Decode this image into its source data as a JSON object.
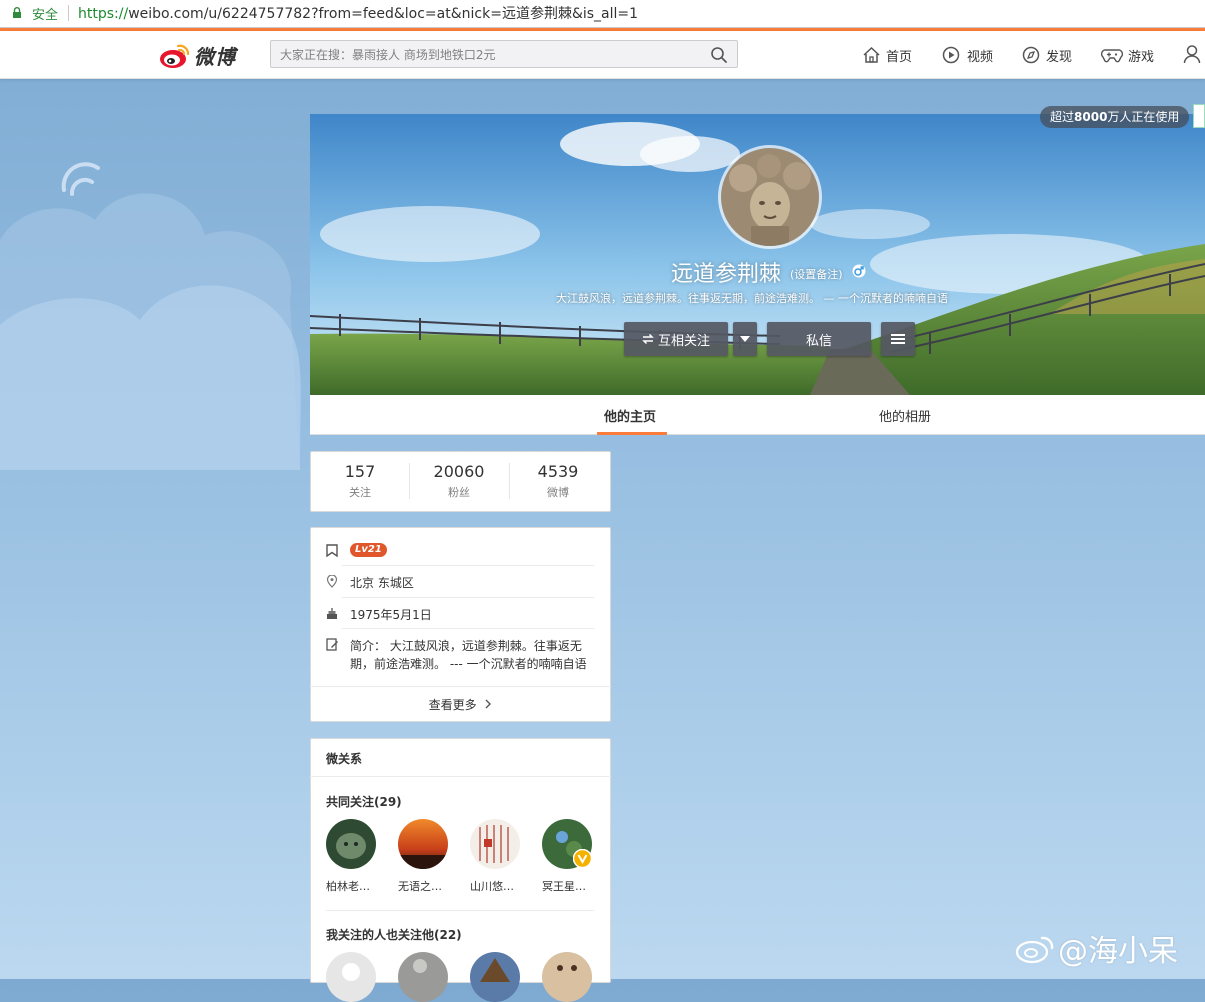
{
  "browser": {
    "secure_label": "安全",
    "url_proto": "https://",
    "url_rest": "weibo.com/u/6224757782?from=feed&loc=at&nick=远道参荆棘&is_all=1"
  },
  "header": {
    "logo_text": "微博",
    "search_placeholder": "大家正在搜：暴雨接人 商场到地铁口2元",
    "nav": [
      {
        "label": "首页",
        "icon": "home-icon"
      },
      {
        "label": "视频",
        "icon": "video-icon"
      },
      {
        "label": "发现",
        "icon": "compass-icon"
      },
      {
        "label": "游戏",
        "icon": "gamepad-icon"
      }
    ]
  },
  "cover": {
    "badge_prefix": "超过",
    "badge_number": "8000",
    "badge_suffix": "万人正在使用",
    "nickname": "远道参荆棘",
    "remark": "(设置备注)",
    "bio": "大江鼓风浪，远道参荆棘。往事返无期，前途浩难测。 — 一个沉默者的喃喃自语",
    "follow_button": "互相关注",
    "message_button": "私信"
  },
  "tabs": [
    {
      "label": "他的主页",
      "active": true
    },
    {
      "label": "他的相册",
      "active": false
    }
  ],
  "stats": [
    {
      "value": "157",
      "label": "关注"
    },
    {
      "value": "20060",
      "label": "粉丝"
    },
    {
      "value": "4539",
      "label": "微博"
    }
  ],
  "info": {
    "level": "Lv21",
    "location": "北京 东城区",
    "birthday": "1975年5月1日",
    "bio_line1": "简介： 大江鼓风浪，远道参荆棘。往事返无",
    "bio_line2": "期，前途浩难测。 --- 一个沉默者的喃喃自语",
    "more": "查看更多"
  },
  "relations": {
    "title": "微关系",
    "common_title": "共同关注(29)",
    "common": [
      {
        "name": "柏林老…"
      },
      {
        "name": "无语之…"
      },
      {
        "name": "山川悠…"
      },
      {
        "name": "冥王星…"
      }
    ],
    "also_title": "我关注的人也关注他(22)"
  },
  "watermark": "@海小呆",
  "colors": {
    "accent": "#fa7d3c",
    "level": "#e0572b",
    "secure": "#2f8a3b"
  }
}
